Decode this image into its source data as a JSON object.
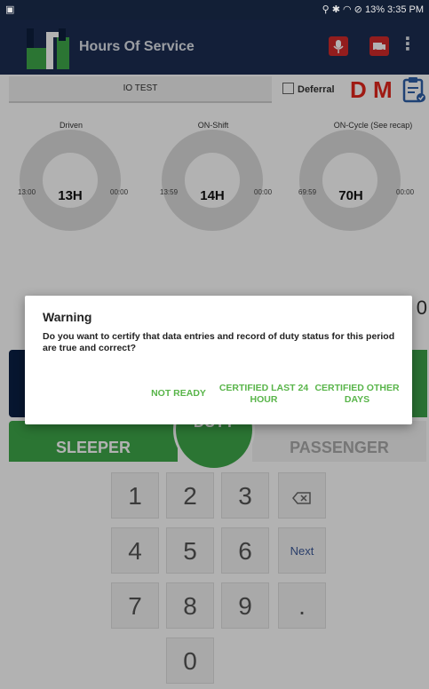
{
  "status_bar": {
    "left_icon": "notification-icon",
    "right_text": "13% 3:35 PM"
  },
  "app_bar": {
    "title": "Hours Of Service",
    "icons": [
      "logo-icon",
      "microphone-icon",
      "truck-icon",
      "kebab-menu-icon"
    ]
  },
  "header": {
    "driver_name": "IO TEST",
    "deferral_label": "Deferral",
    "flag_d": "D",
    "flag_m": "M"
  },
  "gauges": [
    {
      "label": "Driven",
      "left": "13:00",
      "center": "13H",
      "right": "00:00"
    },
    {
      "label": "ON-Shift",
      "left": "13:59",
      "center": "14H",
      "right": "00:00"
    },
    {
      "label": "ON-Cycle (See recap)",
      "left": "69:59",
      "center": "70H",
      "right": "00:00"
    }
  ],
  "stray_digit": "0",
  "duty": {
    "sleeper_label": "SLEEPER",
    "passenger_label": "PASSENGER",
    "duty_label": "DUTY"
  },
  "keypad": {
    "keys": [
      "1",
      "2",
      "3",
      "4",
      "5",
      "6",
      "7",
      "8",
      "9",
      "0"
    ],
    "next_label": "Next",
    "dot_label": "."
  },
  "dialog": {
    "title": "Warning",
    "message": "Do you want to certify that data entries and record of duty status for this period are true and correct?",
    "buttons": {
      "not_ready": "NOT READY",
      "certified_last_24": "CERTIFIED LAST 24 HOUR",
      "certified_other": "CERTIFIED OTHER DAYS"
    }
  },
  "colors": {
    "app_bar": "#1c2d52",
    "accent_green": "#3ea84a",
    "button_green": "#59b54a",
    "flag_red": "#e4261c",
    "duty_blue": "#0b2045"
  }
}
